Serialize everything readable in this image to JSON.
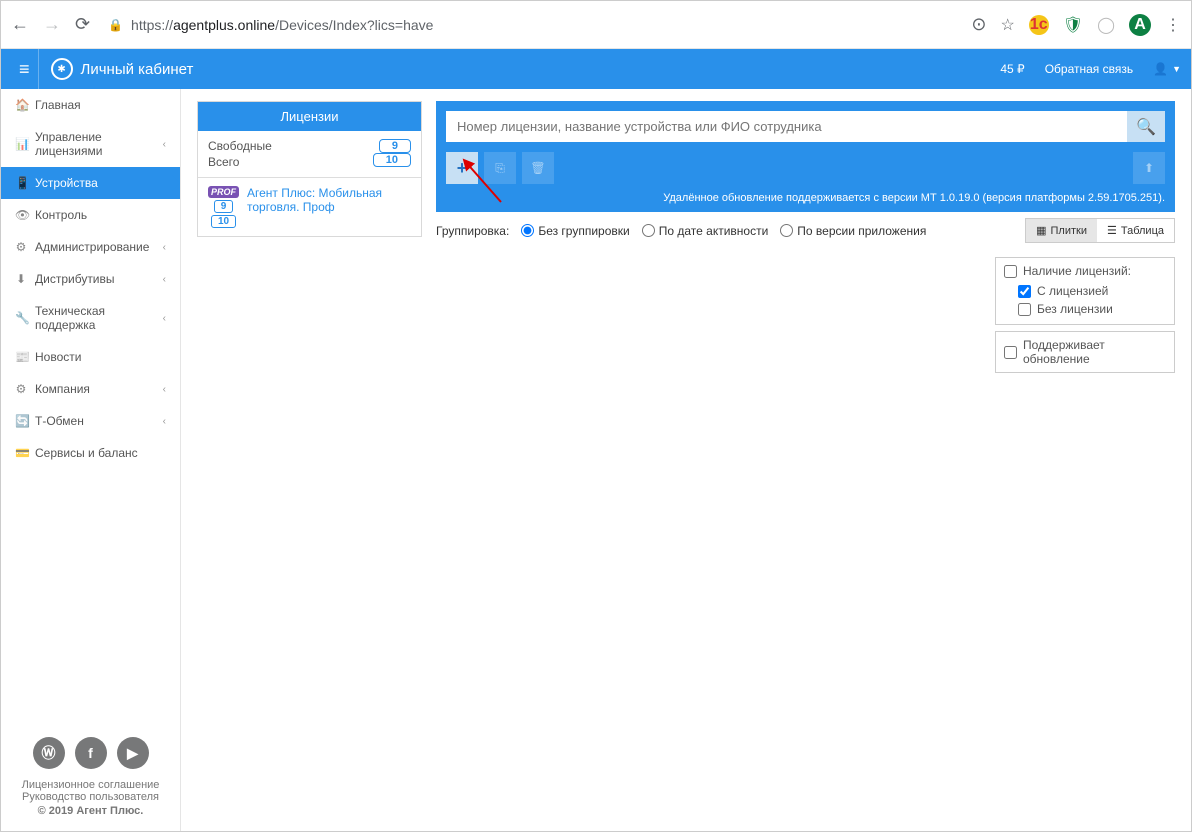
{
  "browser": {
    "url_prefix": "https://",
    "url_domain": "agentplus.online",
    "url_path": "/Devices/Index?lics=have",
    "avatar_letter": "A"
  },
  "header": {
    "title": "Личный кабинет",
    "balance": "45 ₽",
    "feedback": "Обратная связь"
  },
  "sidebar": {
    "items": [
      {
        "icon": "home",
        "label": "Главная",
        "expand": false
      },
      {
        "icon": "sitemap",
        "label": "Управление лицензиями",
        "expand": true
      },
      {
        "icon": "phone",
        "label": "Устройства",
        "expand": false,
        "active": true
      },
      {
        "icon": "eye",
        "label": "Контроль",
        "expand": false
      },
      {
        "icon": "cogs",
        "label": "Администрирование",
        "expand": true
      },
      {
        "icon": "download",
        "label": "Дистрибутивы",
        "expand": true
      },
      {
        "icon": "wrench",
        "label": "Техническая поддержка",
        "expand": true
      },
      {
        "icon": "news",
        "label": "Новости",
        "expand": false
      },
      {
        "icon": "gear",
        "label": "Компания",
        "expand": true
      },
      {
        "icon": "refresh",
        "label": "Т-Обмен",
        "expand": true
      },
      {
        "icon": "card",
        "label": "Сервисы и баланс",
        "expand": false
      }
    ]
  },
  "sidebar_footer": {
    "link_license": "Лицензионное соглашение",
    "link_manual": "Руководство пользователя",
    "copyright": "© 2019 Агент Плюс."
  },
  "licenses_panel": {
    "title": "Лицензии",
    "free_label": "Свободные",
    "free_value": "9",
    "total_label": "Всего",
    "total_value": "10",
    "product_name": "Агент Плюс: Мобильная торговля. Проф",
    "product_free": "9",
    "product_total": "10",
    "prof_tag": "PROF"
  },
  "main_panel": {
    "search_placeholder": "Номер лицензии, название устройства или ФИО сотрудника",
    "notice": "Удалённое обновление поддерживается с версии МТ 1.0.19.0 (версия платформы 2.59.1705.251).",
    "group_label": "Группировка:",
    "group_options": [
      "Без группировки",
      "По дате активности",
      "По версии приложения"
    ],
    "view_tiles": "Плитки",
    "view_table": "Таблица",
    "filter_license_title": "Наличие лицензий:",
    "filter_with_license": "С лицензией",
    "filter_without_license": "Без лицензии",
    "filter_supports_update": "Поддерживает обновление"
  }
}
